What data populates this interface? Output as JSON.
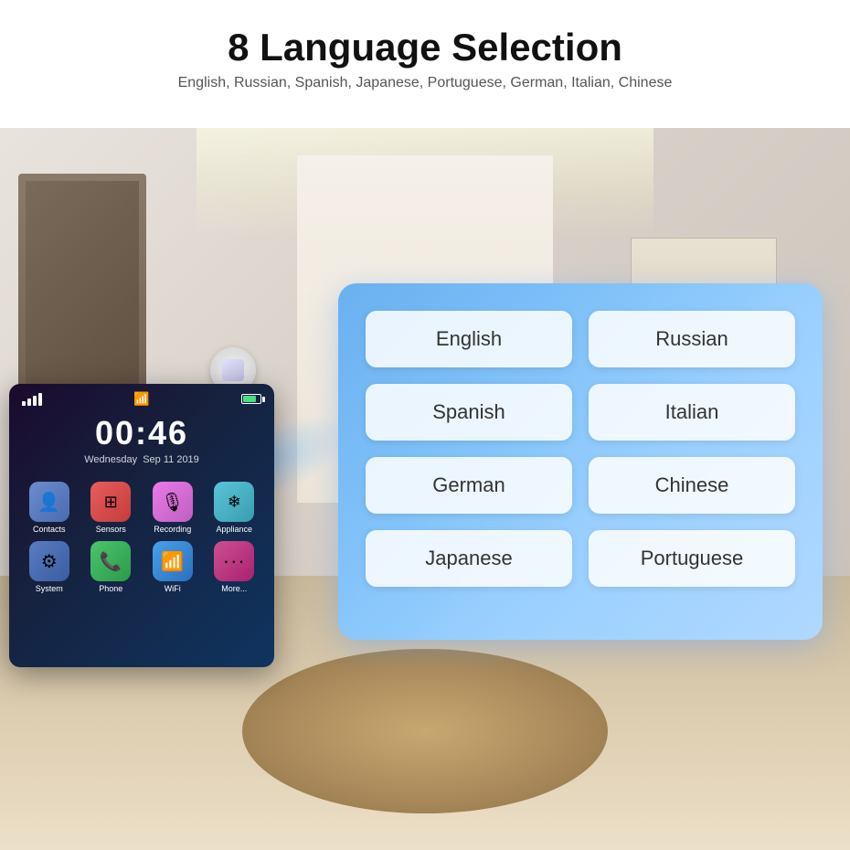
{
  "header": {
    "title": "8 Language Selection",
    "subtitle": "English, Russian, Spanish, Japanese, Portuguese, German, Italian, Chinese"
  },
  "device": {
    "time": "00:46",
    "day": "Wednesday",
    "date": "Sep 11 2019",
    "apps": [
      {
        "id": "contacts",
        "label": "Contacts",
        "class": "app-contacts",
        "icon": "👤"
      },
      {
        "id": "sensors",
        "label": "Sensors",
        "class": "app-sensors",
        "icon": "⊞"
      },
      {
        "id": "recording",
        "label": "Recording",
        "class": "app-recording",
        "icon": "🎙"
      },
      {
        "id": "appliance",
        "label": "Appliance",
        "class": "app-appliance",
        "icon": "❄"
      },
      {
        "id": "system",
        "label": "System",
        "class": "app-system",
        "icon": "⚙"
      },
      {
        "id": "phone",
        "label": "Phone",
        "class": "app-phone",
        "icon": "📞"
      },
      {
        "id": "wifi",
        "label": "WiFi",
        "class": "app-wifi",
        "icon": "📶"
      },
      {
        "id": "more",
        "label": "More...",
        "class": "app-more",
        "icon": "···"
      }
    ]
  },
  "languages": {
    "panel_bg": "#7ec0f8",
    "buttons": [
      {
        "id": "english",
        "label": "English"
      },
      {
        "id": "russian",
        "label": "Russian"
      },
      {
        "id": "spanish",
        "label": "Spanish"
      },
      {
        "id": "italian",
        "label": "Italian"
      },
      {
        "id": "german",
        "label": "German"
      },
      {
        "id": "chinese",
        "label": "Chinese"
      },
      {
        "id": "japanese",
        "label": "Japanese"
      },
      {
        "id": "portuguese",
        "label": "Portuguese"
      }
    ]
  }
}
